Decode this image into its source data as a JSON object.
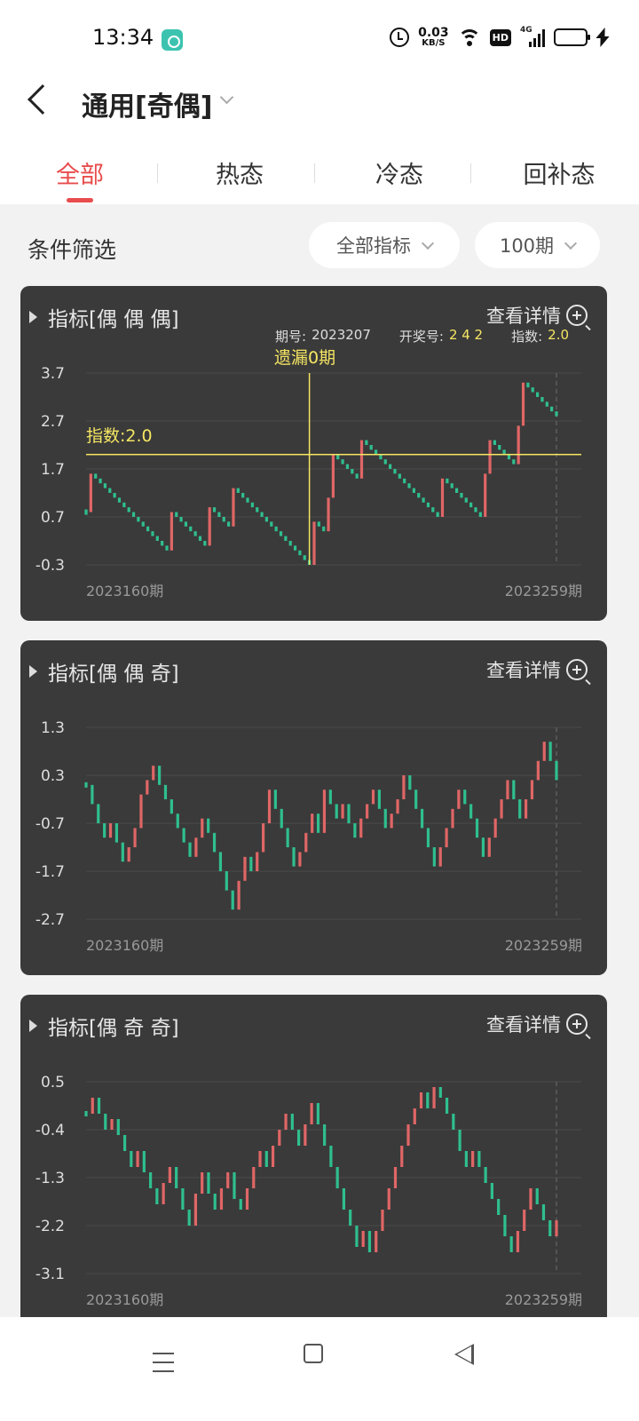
{
  "status_bar": {
    "time": "13:34",
    "net_speed_value": "0.03",
    "net_speed_unit": "KB/S",
    "hd": "HD",
    "network": "4G"
  },
  "header": {
    "title": "通用[奇偶]"
  },
  "tabs": [
    "全部",
    "热态",
    "冷态",
    "回补态"
  ],
  "active_tab": 0,
  "filter": {
    "label": "条件筛选",
    "indicator_dropdown": "全部指标",
    "period_dropdown": "100期"
  },
  "detail_label": "查看详情",
  "colors": {
    "up": "#e06666",
    "down": "#2fbf8f",
    "highlight": "#f5e663",
    "card_bg": "#3a3a3a"
  },
  "tooltip": {
    "period_label": "期号:",
    "period_value": "2023207",
    "draw_label": "开奖号:",
    "draw_value": "2 4 2",
    "index_label": "指数:",
    "index_value": "2.0",
    "miss_label": "遗漏0期",
    "crosshair_label": "指数:2.0"
  },
  "chart_data": [
    {
      "type": "candlestick",
      "title": "指标[偶 偶 偶]",
      "y_ticks": [
        "3.7",
        "2.7",
        "1.7",
        "0.7",
        "-0.3"
      ],
      "ylim": [
        -0.3,
        3.7
      ],
      "x_start_label": "2023160期",
      "x_end_label": "2023259期",
      "crosshair_index": 47,
      "crosshair_value": 2.0,
      "values": [
        0.8,
        1.6,
        1.5,
        1.4,
        1.3,
        1.2,
        1.1,
        1.0,
        0.9,
        0.8,
        0.7,
        0.6,
        0.5,
        0.4,
        0.3,
        0.2,
        0.1,
        0.0,
        0.8,
        0.7,
        0.6,
        0.5,
        0.4,
        0.3,
        0.2,
        0.1,
        0.9,
        0.8,
        0.7,
        0.6,
        0.5,
        1.3,
        1.2,
        1.1,
        1.0,
        0.9,
        0.8,
        0.7,
        0.6,
        0.5,
        0.4,
        0.3,
        0.2,
        0.1,
        0.0,
        -0.1,
        -0.2,
        -0.3,
        0.6,
        0.5,
        0.4,
        1.1,
        2.0,
        1.9,
        1.8,
        1.7,
        1.6,
        1.5,
        2.3,
        2.2,
        2.1,
        2.0,
        1.9,
        1.8,
        1.7,
        1.6,
        1.5,
        1.4,
        1.3,
        1.2,
        1.1,
        1.0,
        0.9,
        0.8,
        0.7,
        1.5,
        1.4,
        1.3,
        1.2,
        1.1,
        1.0,
        0.9,
        0.8,
        0.7,
        1.6,
        2.3,
        2.2,
        2.1,
        2.0,
        1.9,
        1.8,
        2.6,
        3.5,
        3.4,
        3.3,
        3.2,
        3.1,
        3.0,
        2.9,
        2.8
      ]
    },
    {
      "type": "candlestick",
      "title": "指标[偶 偶 奇]",
      "y_ticks": [
        "1.3",
        "0.3",
        "-0.7",
        "-1.7",
        "-2.7"
      ],
      "ylim": [
        -2.7,
        1.3
      ],
      "x_start_label": "2023160期",
      "x_end_label": "2023259期",
      "values": [
        0.1,
        -0.3,
        -0.7,
        -1.0,
        -0.7,
        -1.1,
        -1.5,
        -1.2,
        -0.8,
        -0.1,
        0.2,
        0.5,
        0.1,
        -0.2,
        -0.5,
        -0.8,
        -1.1,
        -1.4,
        -1.0,
        -0.6,
        -0.9,
        -1.3,
        -1.7,
        -2.1,
        -2.5,
        -1.9,
        -1.4,
        -1.7,
        -1.3,
        -0.7,
        0.0,
        -0.4,
        -0.8,
        -1.2,
        -1.6,
        -1.3,
        -0.9,
        -0.5,
        -0.9,
        0.0,
        -0.3,
        -0.6,
        -0.3,
        -0.7,
        -1.0,
        -0.6,
        -0.3,
        0.0,
        -0.4,
        -0.8,
        -0.5,
        -0.2,
        0.3,
        0.0,
        -0.4,
        -0.8,
        -1.2,
        -1.6,
        -1.2,
        -0.8,
        -0.4,
        0.0,
        -0.3,
        -0.6,
        -1.0,
        -1.4,
        -1.0,
        -0.6,
        -0.2,
        0.2,
        -0.2,
        -0.6,
        -0.2,
        0.2,
        0.6,
        1.0,
        0.6,
        0.2
      ]
    },
    {
      "type": "candlestick",
      "title": "指标[偶 奇 奇]",
      "y_ticks": [
        "0.5",
        "-0.4",
        "-1.3",
        "-2.2",
        "-3.1"
      ],
      "ylim": [
        -3.1,
        0.5
      ],
      "x_start_label": "2023160期",
      "x_end_label": "2023259期",
      "values": [
        -0.1,
        0.2,
        -0.1,
        -0.4,
        -0.2,
        -0.5,
        -0.8,
        -1.1,
        -0.8,
        -1.2,
        -1.5,
        -1.8,
        -1.4,
        -1.1,
        -1.5,
        -1.9,
        -2.2,
        -1.6,
        -1.2,
        -1.6,
        -1.9,
        -1.5,
        -1.2,
        -1.7,
        -1.9,
        -1.5,
        -1.1,
        -0.8,
        -1.1,
        -0.7,
        -0.4,
        -0.1,
        -0.4,
        -0.7,
        -0.3,
        0.1,
        -0.3,
        -0.7,
        -1.1,
        -1.5,
        -1.9,
        -2.2,
        -2.6,
        -2.3,
        -2.7,
        -2.3,
        -1.9,
        -1.5,
        -1.1,
        -0.7,
        -0.3,
        0.0,
        0.3,
        0.0,
        0.4,
        0.2,
        -0.1,
        -0.4,
        -0.8,
        -1.1,
        -0.8,
        -1.1,
        -1.4,
        -1.7,
        -2.0,
        -2.4,
        -2.7,
        -2.3,
        -1.9,
        -1.5,
        -1.8,
        -2.1,
        -2.4,
        -2.1
      ]
    }
  ],
  "nav": {
    "menu": "menu-icon",
    "home": "home-icon",
    "back": "back-icon"
  }
}
